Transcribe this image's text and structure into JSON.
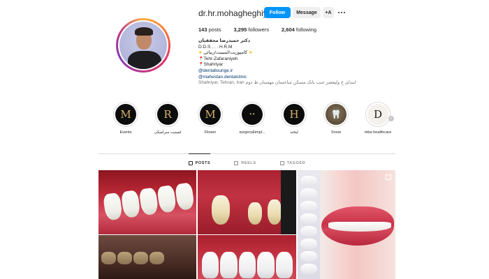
{
  "profile": {
    "username": "dr.hr.mohagheghiyan",
    "follow_label": "Follow",
    "message_label": "Message",
    "add_icon": "+A"
  },
  "stats": {
    "posts_count": "143",
    "posts_label": "posts",
    "followers_count": "3,295",
    "followers_label": "followers",
    "following_count": "2,604",
    "following_label": "following"
  },
  "bio": {
    "name": "دکتر حمیدرضا محققیان",
    "degree": "D.D.S . . . H.R.M",
    "line1": "کامپوزیت/لمینیت/زیبائی",
    "line2": "Tehr-Zafaraniyeh",
    "line3": "Shahriyar",
    "link1": "@dentallounge.ir",
    "link2": "@mahestan.dentalclinic",
    "address": "Shahriyar, Tehran, Iran ابتدای خ ولیعصر جنب بانک مسکن ساختمان مهستان ط دوم"
  },
  "highlights": [
    {
      "label": "Events",
      "glyph": "M",
      "style": "dark"
    },
    {
      "label": "لمینیت سرامیکی",
      "glyph": "R",
      "style": "dark"
    },
    {
      "label": "Flower",
      "glyph": "M",
      "style": "dark"
    },
    {
      "label": "surgery&impl...",
      "glyph": "",
      "style": "logo"
    },
    {
      "label": "لبخند",
      "glyph": "H",
      "style": "dark"
    },
    {
      "label": "Snow",
      "glyph": "",
      "style": "tooth"
    },
    {
      "label": "mba healthcare",
      "glyph": "D",
      "style": "light"
    }
  ],
  "tabs": {
    "posts": "POSTS",
    "reels": "REELS",
    "tagged": "TAGGED"
  },
  "icons": {
    "more": "more-options-icon",
    "next": "chevron-right-icon"
  },
  "colors": {
    "follow_button": "#0095f6",
    "link": "#00376b",
    "text": "#262626"
  }
}
